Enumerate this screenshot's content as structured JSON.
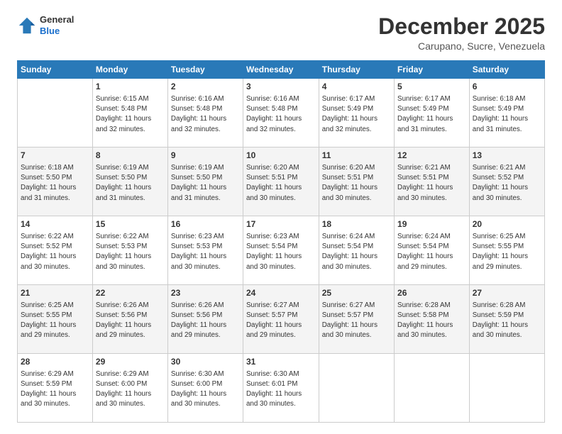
{
  "header": {
    "logo_line1": "General",
    "logo_line2": "Blue",
    "month": "December 2025",
    "location": "Carupano, Sucre, Venezuela"
  },
  "days_of_week": [
    "Sunday",
    "Monday",
    "Tuesday",
    "Wednesday",
    "Thursday",
    "Friday",
    "Saturday"
  ],
  "weeks": [
    [
      {
        "day": "",
        "info": ""
      },
      {
        "day": "1",
        "info": "Sunrise: 6:15 AM\nSunset: 5:48 PM\nDaylight: 11 hours\nand 32 minutes."
      },
      {
        "day": "2",
        "info": "Sunrise: 6:16 AM\nSunset: 5:48 PM\nDaylight: 11 hours\nand 32 minutes."
      },
      {
        "day": "3",
        "info": "Sunrise: 6:16 AM\nSunset: 5:48 PM\nDaylight: 11 hours\nand 32 minutes."
      },
      {
        "day": "4",
        "info": "Sunrise: 6:17 AM\nSunset: 5:49 PM\nDaylight: 11 hours\nand 32 minutes."
      },
      {
        "day": "5",
        "info": "Sunrise: 6:17 AM\nSunset: 5:49 PM\nDaylight: 11 hours\nand 31 minutes."
      },
      {
        "day": "6",
        "info": "Sunrise: 6:18 AM\nSunset: 5:49 PM\nDaylight: 11 hours\nand 31 minutes."
      }
    ],
    [
      {
        "day": "7",
        "info": "Sunrise: 6:18 AM\nSunset: 5:50 PM\nDaylight: 11 hours\nand 31 minutes."
      },
      {
        "day": "8",
        "info": "Sunrise: 6:19 AM\nSunset: 5:50 PM\nDaylight: 11 hours\nand 31 minutes."
      },
      {
        "day": "9",
        "info": "Sunrise: 6:19 AM\nSunset: 5:50 PM\nDaylight: 11 hours\nand 31 minutes."
      },
      {
        "day": "10",
        "info": "Sunrise: 6:20 AM\nSunset: 5:51 PM\nDaylight: 11 hours\nand 30 minutes."
      },
      {
        "day": "11",
        "info": "Sunrise: 6:20 AM\nSunset: 5:51 PM\nDaylight: 11 hours\nand 30 minutes."
      },
      {
        "day": "12",
        "info": "Sunrise: 6:21 AM\nSunset: 5:51 PM\nDaylight: 11 hours\nand 30 minutes."
      },
      {
        "day": "13",
        "info": "Sunrise: 6:21 AM\nSunset: 5:52 PM\nDaylight: 11 hours\nand 30 minutes."
      }
    ],
    [
      {
        "day": "14",
        "info": "Sunrise: 6:22 AM\nSunset: 5:52 PM\nDaylight: 11 hours\nand 30 minutes."
      },
      {
        "day": "15",
        "info": "Sunrise: 6:22 AM\nSunset: 5:53 PM\nDaylight: 11 hours\nand 30 minutes."
      },
      {
        "day": "16",
        "info": "Sunrise: 6:23 AM\nSunset: 5:53 PM\nDaylight: 11 hours\nand 30 minutes."
      },
      {
        "day": "17",
        "info": "Sunrise: 6:23 AM\nSunset: 5:54 PM\nDaylight: 11 hours\nand 30 minutes."
      },
      {
        "day": "18",
        "info": "Sunrise: 6:24 AM\nSunset: 5:54 PM\nDaylight: 11 hours\nand 30 minutes."
      },
      {
        "day": "19",
        "info": "Sunrise: 6:24 AM\nSunset: 5:54 PM\nDaylight: 11 hours\nand 29 minutes."
      },
      {
        "day": "20",
        "info": "Sunrise: 6:25 AM\nSunset: 5:55 PM\nDaylight: 11 hours\nand 29 minutes."
      }
    ],
    [
      {
        "day": "21",
        "info": "Sunrise: 6:25 AM\nSunset: 5:55 PM\nDaylight: 11 hours\nand 29 minutes."
      },
      {
        "day": "22",
        "info": "Sunrise: 6:26 AM\nSunset: 5:56 PM\nDaylight: 11 hours\nand 29 minutes."
      },
      {
        "day": "23",
        "info": "Sunrise: 6:26 AM\nSunset: 5:56 PM\nDaylight: 11 hours\nand 29 minutes."
      },
      {
        "day": "24",
        "info": "Sunrise: 6:27 AM\nSunset: 5:57 PM\nDaylight: 11 hours\nand 29 minutes."
      },
      {
        "day": "25",
        "info": "Sunrise: 6:27 AM\nSunset: 5:57 PM\nDaylight: 11 hours\nand 30 minutes."
      },
      {
        "day": "26",
        "info": "Sunrise: 6:28 AM\nSunset: 5:58 PM\nDaylight: 11 hours\nand 30 minutes."
      },
      {
        "day": "27",
        "info": "Sunrise: 6:28 AM\nSunset: 5:59 PM\nDaylight: 11 hours\nand 30 minutes."
      }
    ],
    [
      {
        "day": "28",
        "info": "Sunrise: 6:29 AM\nSunset: 5:59 PM\nDaylight: 11 hours\nand 30 minutes."
      },
      {
        "day": "29",
        "info": "Sunrise: 6:29 AM\nSunset: 6:00 PM\nDaylight: 11 hours\nand 30 minutes."
      },
      {
        "day": "30",
        "info": "Sunrise: 6:30 AM\nSunset: 6:00 PM\nDaylight: 11 hours\nand 30 minutes."
      },
      {
        "day": "31",
        "info": "Sunrise: 6:30 AM\nSunset: 6:01 PM\nDaylight: 11 hours\nand 30 minutes."
      },
      {
        "day": "",
        "info": ""
      },
      {
        "day": "",
        "info": ""
      },
      {
        "day": "",
        "info": ""
      }
    ]
  ]
}
